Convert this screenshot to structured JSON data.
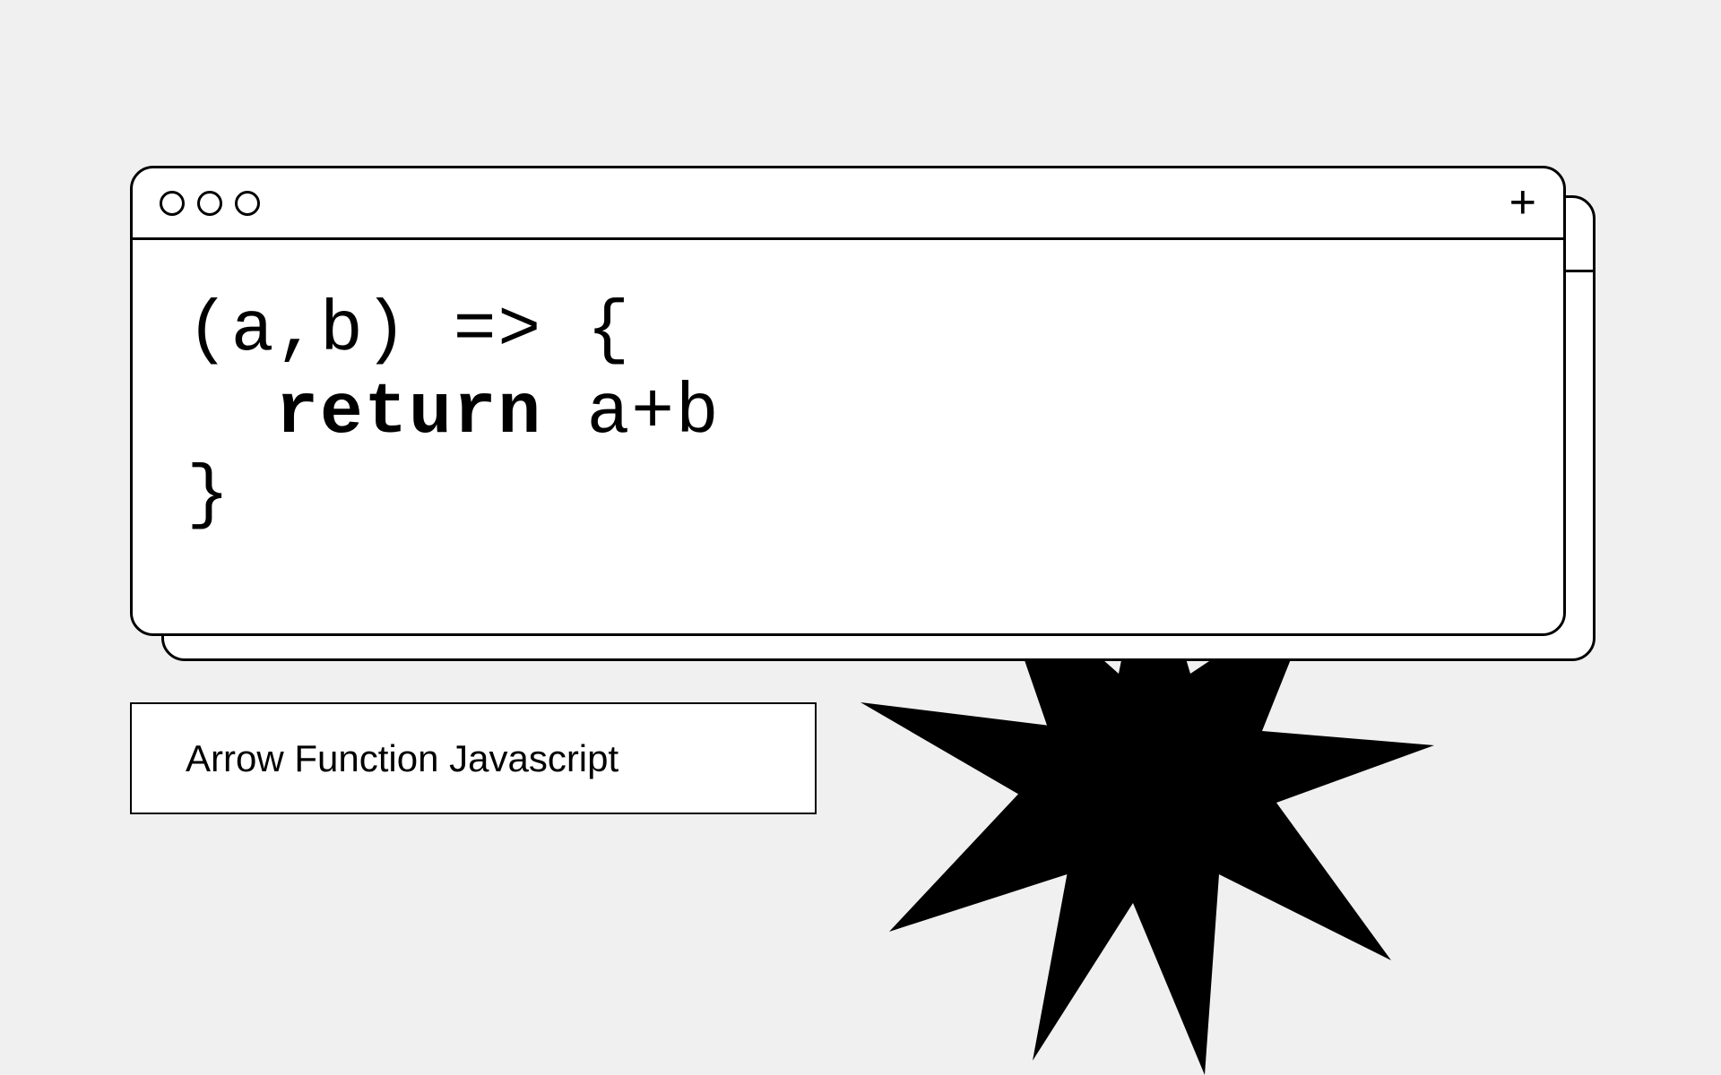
{
  "code": {
    "line1_prefix": "(a,b) => {",
    "line2_indent": "  ",
    "line2_keyword": "return",
    "line2_rest": " a+b",
    "line3": "}"
  },
  "caption": "Arrow Function Javascript",
  "plus_glyph": "+"
}
